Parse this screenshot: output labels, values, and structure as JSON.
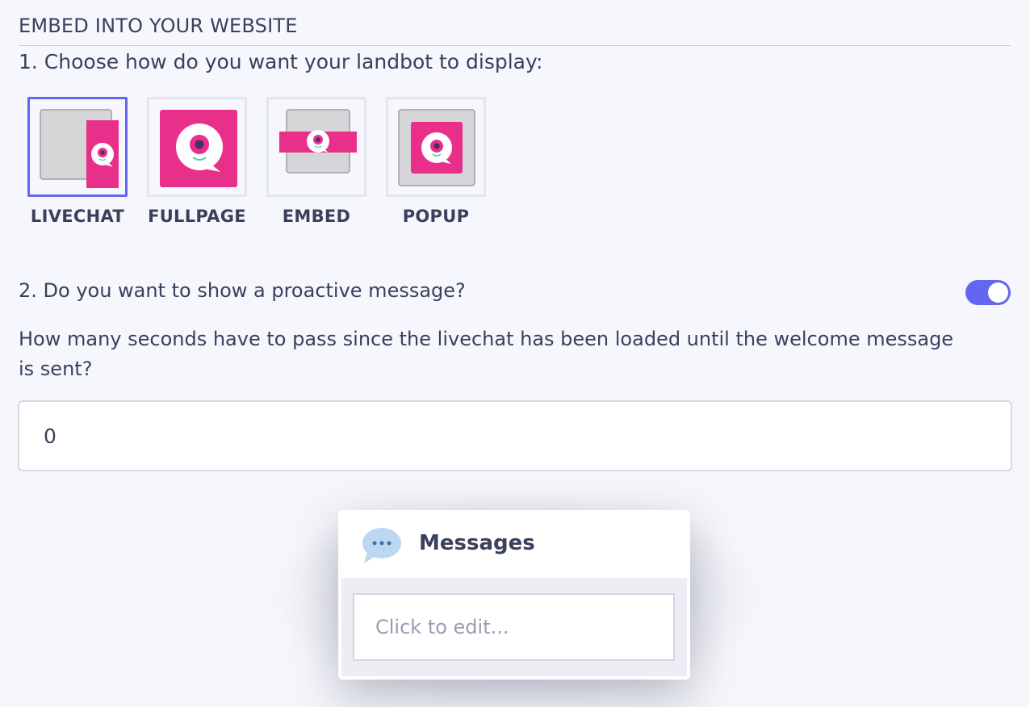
{
  "header": {
    "title": "EMBED INTO YOUR WEBSITE"
  },
  "step1": {
    "label": "1. Choose how do you want your landbot to display:",
    "options": [
      {
        "label": "LIVECHAT",
        "selected": true,
        "icon": "livechat-layout-icon"
      },
      {
        "label": "FULLPAGE",
        "selected": false,
        "icon": "fullpage-layout-icon"
      },
      {
        "label": "EMBED",
        "selected": false,
        "icon": "embed-layout-icon"
      },
      {
        "label": "POPUP",
        "selected": false,
        "icon": "popup-layout-icon"
      }
    ]
  },
  "step2": {
    "label": "2. Do you want to show a proactive message?",
    "toggle_on": true
  },
  "delay": {
    "question": "How many seconds have to pass since the livechat has been loaded until the welcome message is sent?",
    "value": "0"
  },
  "messages": {
    "title": "Messages",
    "icon": "speech-bubble-icon",
    "placeholder": "Click to edit..."
  },
  "colors": {
    "accent": "#6366f1",
    "brand_pink": "#e8308a",
    "text": "#3a3f5c",
    "background": "#f6f7fc"
  }
}
